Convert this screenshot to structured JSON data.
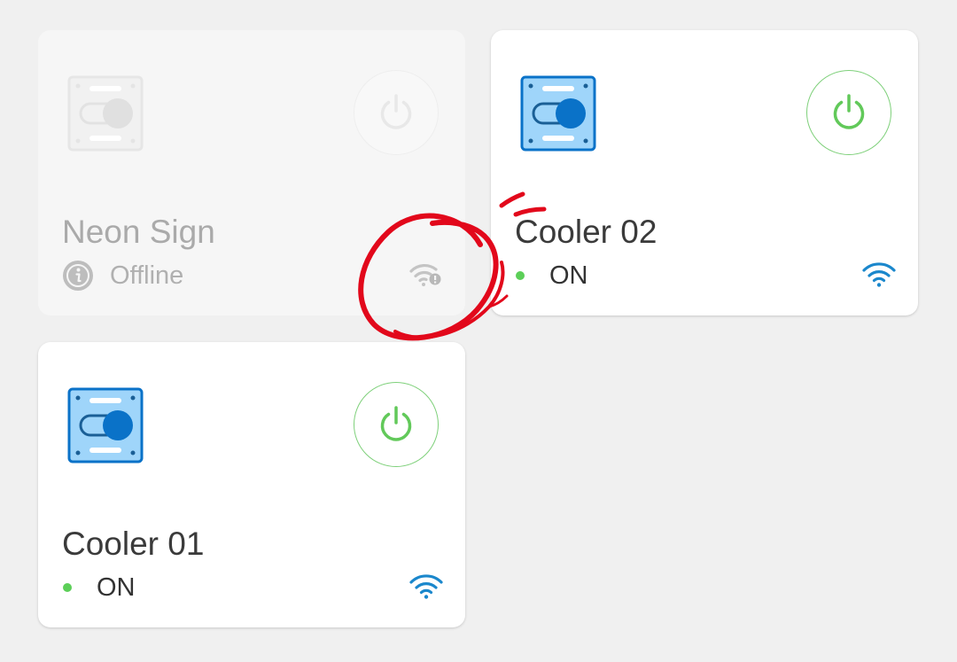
{
  "devices": [
    {
      "name": "Neon Sign",
      "status": "Offline",
      "online": false,
      "icon": "switch-icon",
      "power_icon": "power-icon",
      "signal_icon": "wifi-offline-icon"
    },
    {
      "name": "Cooler 02",
      "status": "ON",
      "online": true,
      "icon": "switch-icon",
      "power_icon": "power-icon",
      "signal_icon": "wifi-icon"
    },
    {
      "name": "Cooler 01",
      "status": "ON",
      "online": true,
      "icon": "switch-icon",
      "power_icon": "power-icon",
      "signal_icon": "wifi-icon"
    }
  ],
  "colors": {
    "background": "#f0f0f0",
    "card": "#ffffff",
    "offline_card": "#f6f6f6",
    "accent_green": "#5ccf58",
    "power_green": "#7ed07a",
    "icon_blue": "#0a72c8",
    "icon_light_blue": "#9fd5fa",
    "wifi_blue": "#1a87cc",
    "annotation_red": "#e2081b"
  }
}
